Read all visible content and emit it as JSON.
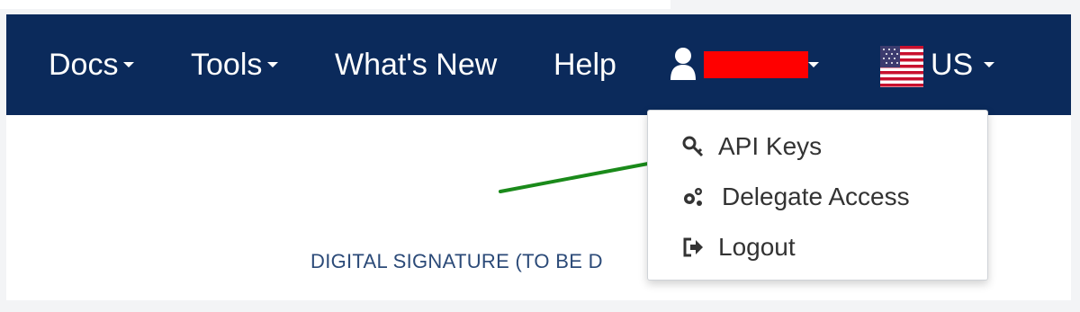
{
  "nav": {
    "docs": "Docs",
    "tools": "Tools",
    "whats_new": "What's New",
    "help": "Help",
    "locale": "US",
    "user_icon": "user-icon",
    "flag_icon": "us-flag-icon"
  },
  "dropdown": {
    "items": [
      {
        "label": "API Keys",
        "icon": "key-icon"
      },
      {
        "label": "Delegate Access",
        "icon": "cogs-icon"
      },
      {
        "label": "Logout",
        "icon": "sign-out-icon"
      }
    ]
  },
  "content": {
    "signature_text": "DIGITAL SIGNATURE (TO BE D"
  },
  "colors": {
    "navbar": "#0b2a5b",
    "redaction": "#ff0000",
    "arrow": "#1a8a1a"
  }
}
